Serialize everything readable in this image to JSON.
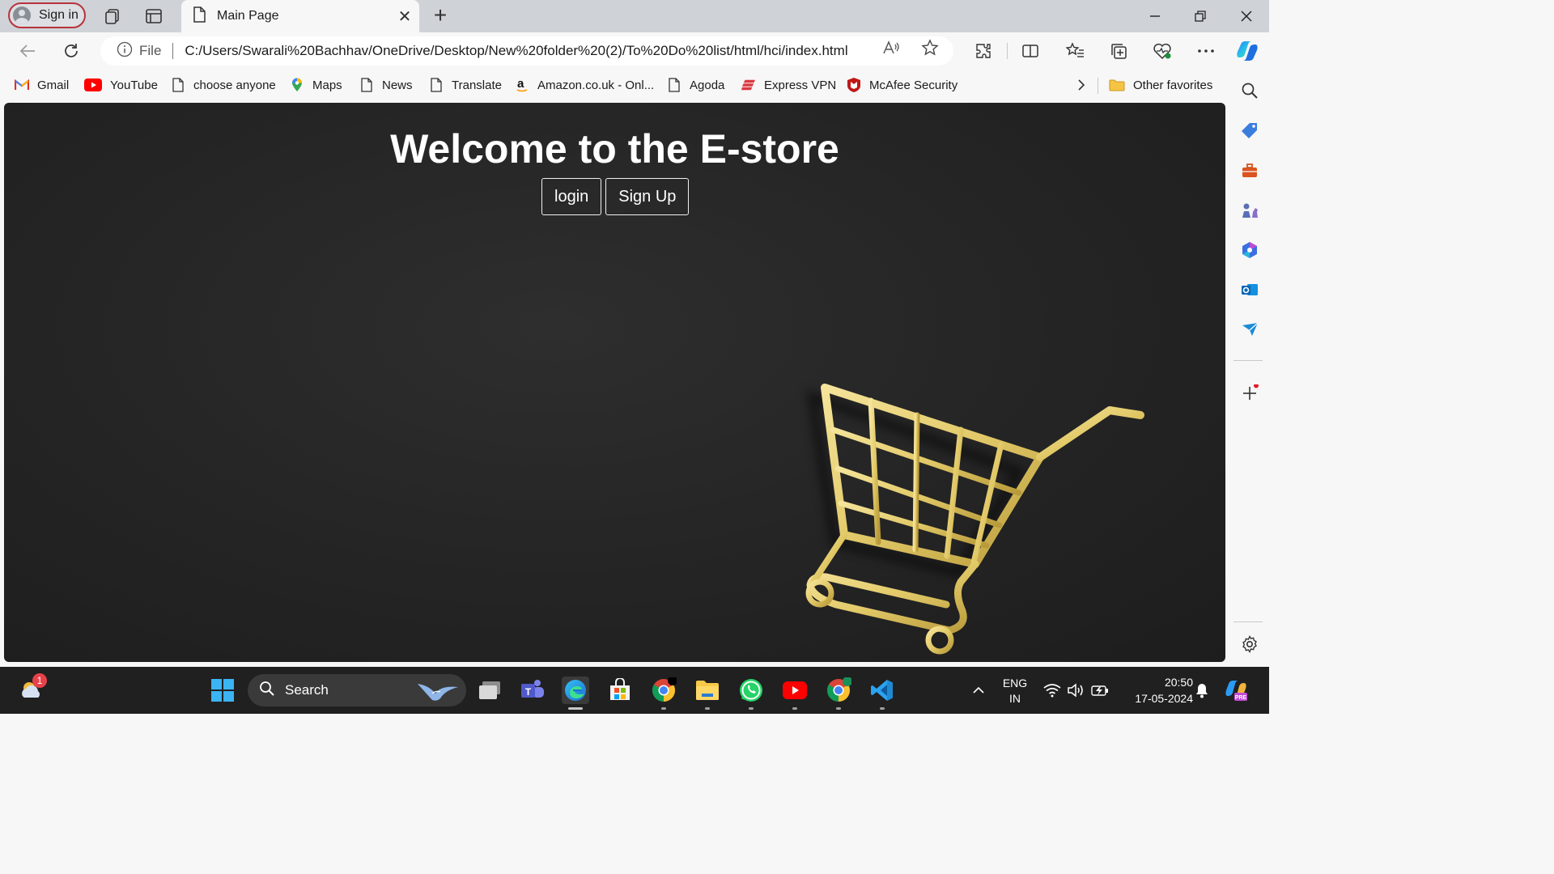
{
  "browser": {
    "signin_label": "Sign in",
    "tab_title": "Main Page",
    "file_label": "File",
    "url": "C:/Users/Swarali%20Bachhav/OneDrive/Desktop/New%20folder%20(2)/To%20Do%20list/html/hci/index.html",
    "favorites": [
      {
        "label": "Gmail",
        "icon": "gmail-icon"
      },
      {
        "label": "YouTube",
        "icon": "youtube-icon"
      },
      {
        "label": "choose anyone",
        "icon": "page-icon"
      },
      {
        "label": "Maps",
        "icon": "maps-pin-icon"
      },
      {
        "label": "News",
        "icon": "page-icon"
      },
      {
        "label": "Translate",
        "icon": "page-icon"
      },
      {
        "label": "Amazon.co.uk - Onl...",
        "icon": "amazon-icon"
      },
      {
        "label": "Agoda",
        "icon": "page-icon"
      },
      {
        "label": "Express VPN",
        "icon": "expressvpn-icon"
      },
      {
        "label": "McAfee Security",
        "icon": "mcafee-icon"
      }
    ],
    "other_favorites": "Other favorites"
  },
  "page": {
    "heading": "Welcome to the E-store",
    "login_label": "login",
    "signup_label": "Sign Up"
  },
  "taskbar": {
    "search_label": "Search",
    "weather_badge": "1",
    "language_line1": "ENG",
    "language_line2": "IN",
    "time": "20:50",
    "date": "17-05-2024"
  },
  "colors": {
    "page_background": "#262626",
    "cart_gold": "#e8d27a",
    "signin_border": "#b9323c",
    "taskbar": "#202020"
  }
}
